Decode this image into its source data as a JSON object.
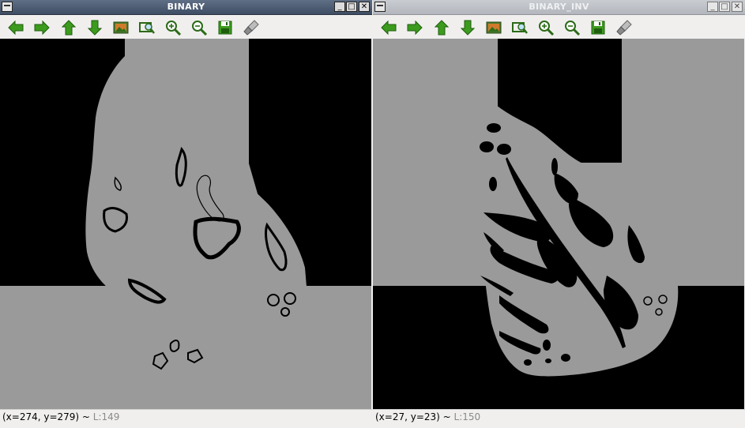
{
  "windows": [
    {
      "title": "BINARY",
      "status": {
        "coords": "(x=274, y=279) ~ ",
        "level": "L:149"
      }
    },
    {
      "title": "BINARY_INV",
      "status": {
        "coords": "(x=27, y=23) ~ ",
        "level": "L:150"
      }
    }
  ],
  "toolbar_icons": [
    "arrow-left-icon",
    "arrow-right-icon",
    "arrow-up-icon",
    "arrow-down-icon",
    "save-image-icon",
    "zoom-fit-icon",
    "zoom-in-icon",
    "zoom-out-icon",
    "save-icon",
    "properties-icon"
  ],
  "colors": {
    "foreground_gray": "#9a9a9a",
    "background_black": "#000000",
    "icon_green": "#3c9b1e",
    "titlebar_active": "#4a5a72",
    "titlebar_inactive": "#c0c3c8"
  }
}
